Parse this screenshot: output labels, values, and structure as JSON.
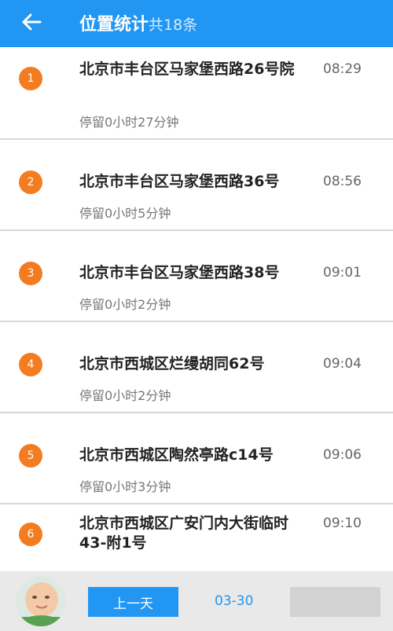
{
  "header": {
    "title": "位置统计",
    "count_text": "共18条"
  },
  "items": [
    {
      "index": "1",
      "address": "北京市丰台区马家堡西路26号院",
      "time": "08:29",
      "stay": "停留0小时27分钟"
    },
    {
      "index": "2",
      "address": "北京市丰台区马家堡西路36号",
      "time": "08:56",
      "stay": "停留0小时5分钟"
    },
    {
      "index": "3",
      "address": "北京市丰台区马家堡西路38号",
      "time": "09:01",
      "stay": "停留0小时2分钟"
    },
    {
      "index": "4",
      "address": "北京市西城区烂缦胡同62号",
      "time": "09:04",
      "stay": "停留0小时2分钟"
    },
    {
      "index": "5",
      "address": "北京市西城区陶然亭路c14号",
      "time": "09:06",
      "stay": "停留0小时3分钟"
    },
    {
      "index": "6",
      "address": "北京市西城区广安门内大街临时43-附1号",
      "time": "09:10",
      "stay": ""
    }
  ],
  "bottom_bar": {
    "prev_day_label": "上一天",
    "date": "03-30"
  },
  "colors": {
    "primary": "#2196f3",
    "badge": "#f47c20"
  },
  "icons": {
    "back": "arrow-left-icon"
  }
}
